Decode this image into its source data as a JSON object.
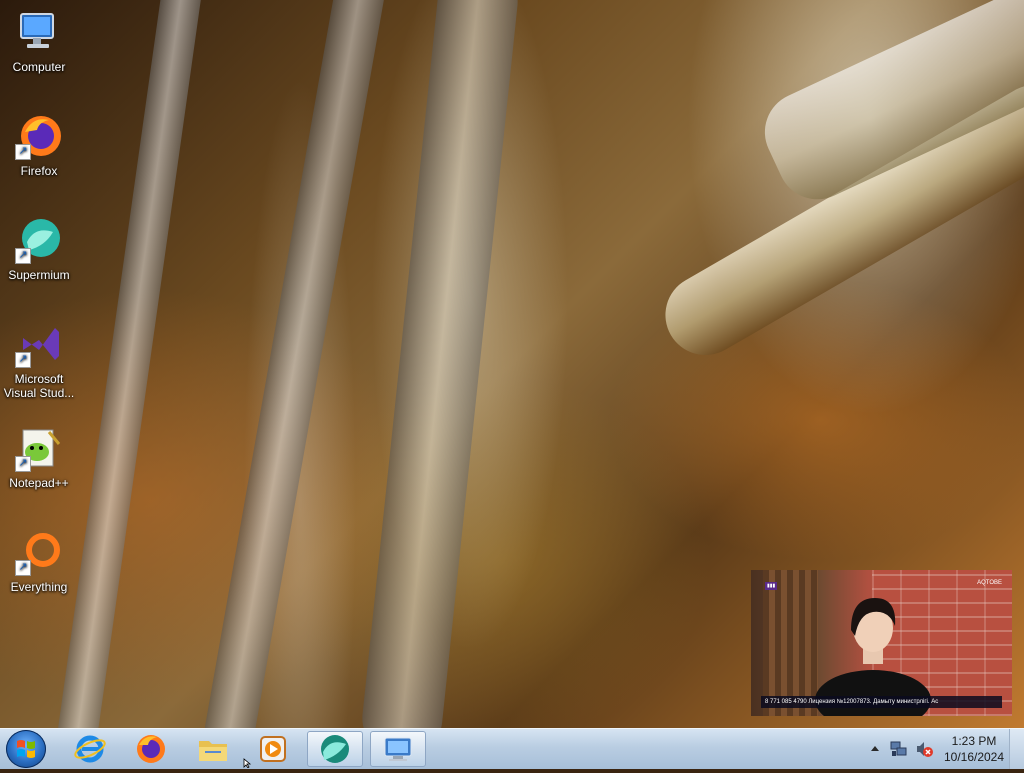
{
  "desktop": {
    "icons": [
      {
        "label": "Computer",
        "icon": "computer-icon",
        "shortcut": false
      },
      {
        "label": "Firefox",
        "icon": "firefox-icon",
        "shortcut": true
      },
      {
        "label": "Supermium",
        "icon": "supermium-icon",
        "shortcut": true
      },
      {
        "label": "Microsoft Visual Stud...",
        "icon": "visual-studio-icon",
        "shortcut": true
      },
      {
        "label": "Notepad++",
        "icon": "notepadpp-icon",
        "shortcut": true
      },
      {
        "label": "Everything",
        "icon": "everything-icon",
        "shortcut": true
      }
    ]
  },
  "tv_overlay": {
    "channel_logo": "AQTOBE",
    "ticker": "8 771 085 4790  Лицензия №12007873. Дамыту министрлігі. Ас"
  },
  "taskbar": {
    "start": {
      "icon": "windows-start-icon"
    },
    "pinned": [
      {
        "name": "Internet Explorer",
        "icon": "internet-explorer-icon",
        "active": false
      },
      {
        "name": "Firefox",
        "icon": "firefox-icon",
        "active": false
      },
      {
        "name": "Windows Explorer",
        "icon": "folder-icon",
        "active": false
      },
      {
        "name": "Windows Media Player",
        "icon": "media-player-icon",
        "active": false
      },
      {
        "name": "Supermium",
        "icon": "supermium-icon",
        "active": true
      },
      {
        "name": "Remote Desktop",
        "icon": "remote-desktop-icon",
        "active": true
      }
    ],
    "tray": {
      "icons": [
        "show-hidden-icons-icon",
        "network-icon",
        "volume-muted-icon"
      ]
    },
    "clock": {
      "time": "1:23 PM",
      "date": "10/16/2024"
    }
  },
  "colors": {
    "taskbar_top": "#d6e4f2",
    "taskbar_bottom": "#a7bfd8",
    "start_orb": "#2a6dc0",
    "desktop_label_text": "#ffffff"
  }
}
